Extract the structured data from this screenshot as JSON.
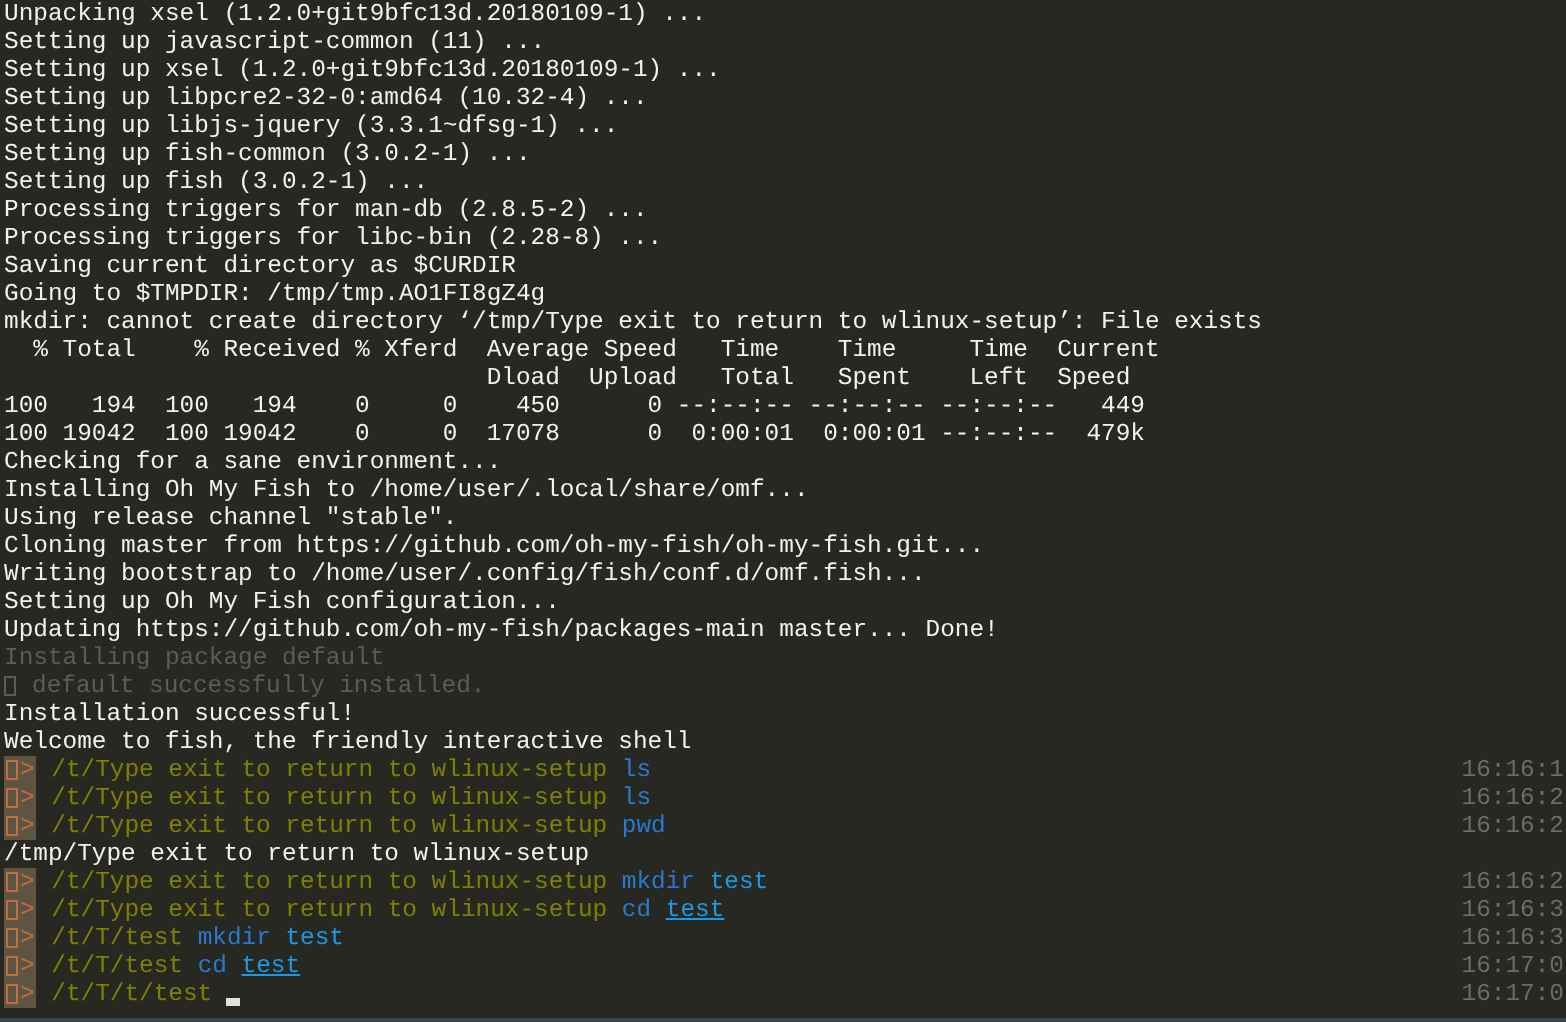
{
  "terminal": {
    "lines": [
      {
        "kind": "output",
        "dimmed": false,
        "text": "Unpacking xsel (1.2.0+git9bfc13d.20180109-1) ..."
      },
      {
        "kind": "output",
        "dimmed": false,
        "text": "Setting up javascript-common (11) ..."
      },
      {
        "kind": "output",
        "dimmed": false,
        "text": "Setting up xsel (1.2.0+git9bfc13d.20180109-1) ..."
      },
      {
        "kind": "output",
        "dimmed": false,
        "text": "Setting up libpcre2-32-0:amd64 (10.32-4) ..."
      },
      {
        "kind": "output",
        "dimmed": false,
        "text": "Setting up libjs-jquery (3.3.1~dfsg-1) ..."
      },
      {
        "kind": "output",
        "dimmed": false,
        "text": "Setting up fish-common (3.0.2-1) ..."
      },
      {
        "kind": "output",
        "dimmed": false,
        "text": "Setting up fish (3.0.2-1) ..."
      },
      {
        "kind": "output",
        "dimmed": false,
        "text": "Processing triggers for man-db (2.8.5-2) ..."
      },
      {
        "kind": "output",
        "dimmed": false,
        "text": "Processing triggers for libc-bin (2.28-8) ..."
      },
      {
        "kind": "output",
        "dimmed": false,
        "text": "Saving current directory as $CURDIR"
      },
      {
        "kind": "output",
        "dimmed": false,
        "text": "Going to $TMPDIR: /tmp/tmp.AO1FI8gZ4g"
      },
      {
        "kind": "output",
        "dimmed": false,
        "text": "mkdir: cannot create directory ‘/tmp/Type exit to return to wlinux-setup’: File exists"
      },
      {
        "kind": "output",
        "dimmed": false,
        "text": "  % Total    % Received % Xferd  Average Speed   Time    Time     Time  Current"
      },
      {
        "kind": "output",
        "dimmed": false,
        "text": "                                 Dload  Upload   Total   Spent    Left  Speed"
      },
      {
        "kind": "output",
        "dimmed": false,
        "text": "100   194  100   194    0     0    450      0 --:--:-- --:--:-- --:--:--   449"
      },
      {
        "kind": "output",
        "dimmed": false,
        "text": "100 19042  100 19042    0     0  17078      0  0:00:01  0:00:01 --:--:--  479k"
      },
      {
        "kind": "output",
        "dimmed": false,
        "text": "Checking for a sane environment..."
      },
      {
        "kind": "output",
        "dimmed": false,
        "text": "Installing Oh My Fish to /home/user/.local/share/omf..."
      },
      {
        "kind": "output",
        "dimmed": false,
        "text": "Using release channel \"stable\"."
      },
      {
        "kind": "output",
        "dimmed": false,
        "text": "Cloning master from https://github.com/oh-my-fish/oh-my-fish.git..."
      },
      {
        "kind": "output",
        "dimmed": false,
        "text": "Writing bootstrap to /home/user/.config/fish/conf.d/omf.fish..."
      },
      {
        "kind": "output",
        "dimmed": false,
        "text": "Setting up Oh My Fish configuration..."
      },
      {
        "kind": "output",
        "dimmed": false,
        "text": "Updating https://github.com/oh-my-fish/packages-main master... Done!"
      },
      {
        "kind": "output",
        "dimmed": true,
        "text": "Installing package default"
      },
      {
        "kind": "output",
        "dimmed": true,
        "glyph": true,
        "text": "default successfully installed."
      },
      {
        "kind": "output",
        "dimmed": false,
        "text": "Installation successful!"
      },
      {
        "kind": "output",
        "dimmed": false,
        "text": "Welcome to fish, the friendly interactive shell"
      },
      {
        "kind": "prompt",
        "symbol": ">",
        "path": "/t/Type exit to return to wlinux-setup",
        "command": "ls",
        "time": "16:16:1"
      },
      {
        "kind": "prompt",
        "symbol": ">",
        "path": "/t/Type exit to return to wlinux-setup",
        "command": "ls",
        "time": "16:16:2"
      },
      {
        "kind": "prompt",
        "symbol": ">",
        "path": "/t/Type exit to return to wlinux-setup",
        "command": "pwd",
        "time": "16:16:2"
      },
      {
        "kind": "output",
        "dimmed": false,
        "text": "/tmp/Type exit to return to wlinux-setup"
      },
      {
        "kind": "prompt",
        "symbol": ">",
        "path": "/t/Type exit to return to wlinux-setup",
        "command": "mkdir",
        "args": [
          {
            "text": "test",
            "underlined": false
          }
        ],
        "time": "16:16:2"
      },
      {
        "kind": "prompt",
        "symbol": ">",
        "path": "/t/Type exit to return to wlinux-setup",
        "command": "cd",
        "args": [
          {
            "text": "test",
            "underlined": true
          }
        ],
        "time": "16:16:3"
      },
      {
        "kind": "prompt",
        "symbol": ">",
        "path": "/t/T/test",
        "command": "mkdir",
        "args": [
          {
            "text": "test",
            "underlined": false
          }
        ],
        "time": "16:16:3"
      },
      {
        "kind": "prompt",
        "symbol": ">",
        "path": "/t/T/test",
        "command": "cd",
        "args": [
          {
            "text": "test",
            "underlined": true
          }
        ],
        "time": "16:17:0"
      },
      {
        "kind": "prompt",
        "symbol": ">",
        "path": "/t/T/t/test",
        "cursor": true,
        "time": "16:17:0"
      }
    ]
  }
}
